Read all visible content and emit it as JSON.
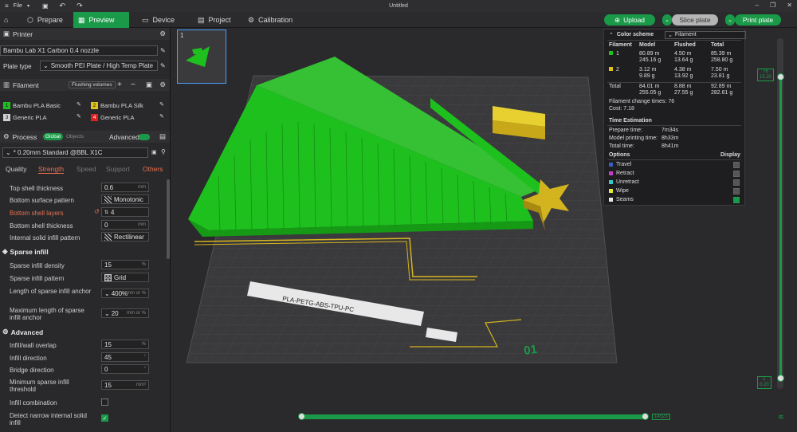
{
  "window": {
    "title": "Untitled",
    "menu_file": "File"
  },
  "tabs": [
    {
      "label": "Prepare"
    },
    {
      "label": "Preview"
    },
    {
      "label": "Device"
    },
    {
      "label": "Project"
    },
    {
      "label": "Calibration"
    }
  ],
  "actions": {
    "upload": "Upload",
    "slice": "Slice plate",
    "print": "Print plate"
  },
  "printer": {
    "section": "Printer",
    "name": "Bambu Lab X1 Carbon 0.4 nozzle",
    "plate_label": "Plate type",
    "plate_value": "Smooth PEI Plate / High Temp Plate"
  },
  "filament": {
    "section": "Filament",
    "flushing": "Flushing volumes",
    "items": [
      {
        "num": "1",
        "name": "Bambu PLA Basic",
        "color": "#1ec01e"
      },
      {
        "num": "2",
        "name": "Bambu PLA Silk",
        "color": "#e0c21a"
      },
      {
        "num": "3",
        "name": "Generic PLA",
        "color": "#d0d0d0"
      },
      {
        "num": "4",
        "name": "Generic PLA",
        "color": "#e02020"
      }
    ]
  },
  "process": {
    "section": "Process",
    "toggle_global": "Global",
    "toggle_objects": "Objects",
    "advanced": "Advanced",
    "preset": "* 0.20mm Standard @BBL X1C",
    "tabs": [
      "Quality",
      "Strength",
      "Speed",
      "Support",
      "Others"
    ]
  },
  "settings": {
    "top_shell_thickness": {
      "label": "Top shell thickness",
      "value": "0.6",
      "unit": "mm"
    },
    "bottom_surface_pattern": {
      "label": "Bottom surface pattern",
      "value": "Monotonic"
    },
    "bottom_shell_layers": {
      "label": "Bottom shell layers",
      "value": "4"
    },
    "bottom_shell_thickness": {
      "label": "Bottom shell thickness",
      "value": "0",
      "unit": "mm"
    },
    "internal_solid_infill_pattern": {
      "label": "Internal solid infill pattern",
      "value": "Rectilinear"
    },
    "sparse_infill_header": "Sparse infill",
    "sparse_infill_density": {
      "label": "Sparse infill density",
      "value": "15",
      "unit": "%"
    },
    "sparse_infill_pattern": {
      "label": "Sparse infill pattern",
      "value": "Grid"
    },
    "length_anchor": {
      "label": "Length of sparse infill anchor",
      "value": "400%",
      "unit": "mm or %"
    },
    "max_length_anchor": {
      "label": "Maximum length of sparse infill anchor",
      "value": "20",
      "unit": "mm or %"
    },
    "advanced_header": "Advanced",
    "infill_wall_overlap": {
      "label": "Infill/wall overlap",
      "value": "15",
      "unit": "%"
    },
    "infill_direction": {
      "label": "Infill direction",
      "value": "45",
      "unit": "°"
    },
    "bridge_direction": {
      "label": "Bridge direction",
      "value": "0",
      "unit": "°"
    },
    "min_sparse_infill": {
      "label": "Minimum sparse infill threshold",
      "value": "15",
      "unit": "mm²"
    },
    "infill_combination": {
      "label": "Infill combination",
      "checked": false
    },
    "detect_narrow": {
      "label": "Detect narrow internal solid infill",
      "checked": true
    }
  },
  "plate_thumb": {
    "number": "1"
  },
  "stats": {
    "color_scheme_label": "Color scheme",
    "color_scheme_value": "Filament",
    "headers": [
      "Filament",
      "Model",
      "Flushed",
      "Total"
    ],
    "rows": [
      {
        "id": "1",
        "color": "#1ec01e",
        "model": [
          "80.89 m",
          "245.16 g"
        ],
        "flushed": [
          "4.50 m",
          "13.64 g"
        ],
        "total": [
          "85.39 m",
          "258.80 g"
        ]
      },
      {
        "id": "2",
        "color": "#e0c21a",
        "model": [
          "3.12 m",
          "9.89 g"
        ],
        "flushed": [
          "4.38 m",
          "13.92 g"
        ],
        "total": [
          "7.50 m",
          "23.81 g"
        ]
      }
    ],
    "total_row": {
      "label": "Total",
      "model": [
        "84.01 m",
        "255.05 g"
      ],
      "flushed": [
        "8.88 m",
        "27.55 g"
      ],
      "total": [
        "92.89 m",
        "282.61 g"
      ]
    },
    "change_times_label": "Filament change times:",
    "change_times": "76",
    "cost_label": "Cost:",
    "cost": "7.18",
    "time_header": "Time Estimation",
    "prepare_label": "Prepare time:",
    "prepare": "7m34s",
    "model_label": "Model printing time:",
    "model": "8h33m",
    "total_label": "Total time:",
    "total": "8h41m",
    "options_label": "Options",
    "display_label": "Display",
    "options": [
      {
        "name": "Travel",
        "color": "#3a5cc8",
        "on": false
      },
      {
        "name": "Retract",
        "color": "#c83ac8",
        "on": false
      },
      {
        "name": "Unretract",
        "color": "#3ac8c8",
        "on": false
      },
      {
        "name": "Wipe",
        "color": "#e8e840",
        "on": false
      },
      {
        "name": "Seams",
        "color": "#e8e8e8",
        "on": true
      }
    ]
  },
  "layer_slider": {
    "top_value": "76",
    "top_height": "15.20",
    "bottom_value": "1",
    "bottom_height": "0.20"
  },
  "move_slider": {
    "value": "14523"
  },
  "bed": {
    "brand": "PLA-PETG-ABS-TPU-PC",
    "number": "01"
  }
}
